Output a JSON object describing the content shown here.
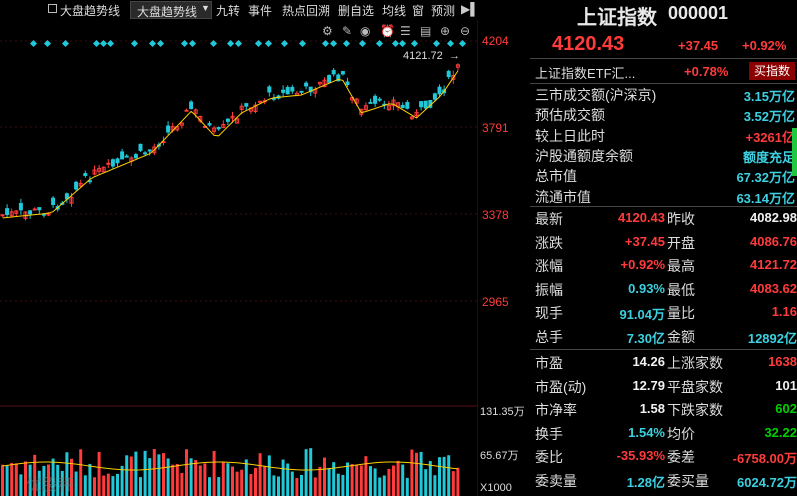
{
  "toolbar": {
    "checkbox_label": "大盘趋势线",
    "select_value": "大盘趋势线",
    "items": [
      "九转",
      "事件",
      "热点回溯",
      "删自选",
      "均线",
      "窗",
      "预测"
    ]
  },
  "chart": {
    "price_labels": [
      "4204",
      "3791",
      "3378",
      "2965"
    ],
    "current_label": "4121.72",
    "volume_labels": [
      "131.35万",
      "65.67万",
      "X1000"
    ],
    "watermark": "优股秤"
  },
  "header": {
    "title": "上证指数",
    "code": "000001",
    "price": "4120.43",
    "change": "+37.45",
    "change_pct": "+0.92%"
  },
  "etf": {
    "name": "上证指数ETF汇...",
    "pct": "+0.78%",
    "button": "买指数"
  },
  "market": [
    {
      "label": "三市成交额(沪深京)",
      "value": "3.15万亿",
      "color": "cyan"
    },
    {
      "label": "预估成交额",
      "value": "3.52万亿",
      "color": "cyan"
    },
    {
      "label": "较上日此时",
      "value": "+3261亿",
      "color": "red"
    },
    {
      "label": "沪股通额度余额",
      "value": "额度充足",
      "color": "cyan"
    },
    {
      "label": "总市值",
      "value": "67.32万亿",
      "color": "cyan"
    },
    {
      "label": "流通市值",
      "value": "63.14万亿",
      "color": "cyan"
    }
  ],
  "quotes": [
    {
      "l1": "最新",
      "v1": "4120.43",
      "c1": "red",
      "l2": "昨收",
      "v2": "4082.98",
      "c2": "white"
    },
    {
      "l1": "涨跌",
      "v1": "+37.45",
      "c1": "red",
      "l2": "开盘",
      "v2": "4086.76",
      "c2": "red"
    },
    {
      "l1": "涨幅",
      "v1": "+0.92%",
      "c1": "red",
      "l2": "最高",
      "v2": "4121.72",
      "c2": "red"
    },
    {
      "l1": "振幅",
      "v1": "0.93%",
      "c1": "cyan",
      "l2": "最低",
      "v2": "4083.62",
      "c2": "red"
    },
    {
      "l1": "现手",
      "v1": "91.04万",
      "c1": "cyan",
      "l2": "量比",
      "v2": "1.16",
      "c2": "red"
    },
    {
      "l1": "总手",
      "v1": "7.30亿",
      "c1": "cyan",
      "l2": "金额",
      "v2": "12892亿",
      "c2": "cyan"
    }
  ],
  "stats": [
    {
      "l1": "市盈",
      "v1": "14.26",
      "c1": "white",
      "l2": "上涨家数",
      "v2": "1638",
      "c2": "red"
    },
    {
      "l1": "市盈(动)",
      "v1": "12.79",
      "c1": "white",
      "l2": "平盘家数",
      "v2": "101",
      "c2": "white"
    },
    {
      "l1": "市净率",
      "v1": "1.58",
      "c1": "white",
      "l2": "下跌家数",
      "v2": "602",
      "c2": "green"
    },
    {
      "l1": "换手",
      "v1": "1.54%",
      "c1": "cyan",
      "l2": "均价",
      "v2": "32.22",
      "c2": "green"
    },
    {
      "l1": "委比",
      "v1": "-35.93%",
      "c1": "red",
      "l2": "委差",
      "v2": "-6758.00万",
      "c2": "red"
    },
    {
      "l1": "委卖量",
      "v1": "1.28亿",
      "c1": "cyan",
      "l2": "委买量",
      "v2": "6024.72万",
      "c2": "cyan"
    }
  ],
  "colors": {
    "up": "#ff3b3b",
    "down": "#00c8d8",
    "ma": "#ffd000",
    "grid": "#2a0b0b"
  }
}
